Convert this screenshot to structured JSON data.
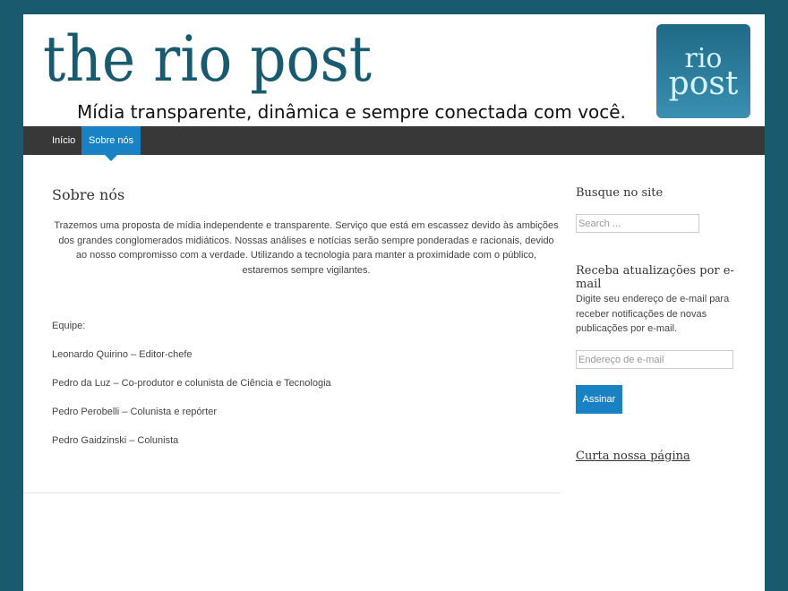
{
  "header": {
    "site_title": "the rio post",
    "tagline": "Mídia transparente, dinâmica e sempre conectada com você.",
    "logo_line1": "rio",
    "logo_line2": "post"
  },
  "nav": {
    "items": [
      {
        "label": "Início",
        "active": false
      },
      {
        "label": "Sobre nós",
        "active": true
      }
    ]
  },
  "main": {
    "title": "Sobre nós",
    "intro": "Trazemos uma proposta de mídia independente e transparente. Serviço que está em escassez devido às ambições dos grandes conglomerados midiáticos. Nossas análises e notícias serão sempre ponderadas e racionais, devido ao nosso compromisso com a verdade. Utilizando a tecnologia para manter a proximidade com o público, estaremos sempre vigilantes.",
    "team_heading": "Equipe:",
    "team": [
      "Leonardo Quirino – Editor-chefe",
      "Pedro da Luz – Co-produtor e colunista de Ciência e Tecnologia",
      "Pedro Perobelli – Colunista e repórter",
      "Pedro Gaidzinski – Colunista"
    ]
  },
  "sidebar": {
    "search_title": "Busque no site",
    "search_placeholder": "Search ...",
    "email_title": "Receba atualizações por e-mail",
    "email_description": "Digite seu endereço de e-mail para receber notificações de novas publicações por e-mail.",
    "email_placeholder": "Endereço de e-mail",
    "subscribe_label": "Assinar",
    "facebook_link": "Curta nossa página"
  },
  "colors": {
    "background": "#1a5a6e",
    "accent": "#1982c4",
    "navbar": "#383838"
  }
}
